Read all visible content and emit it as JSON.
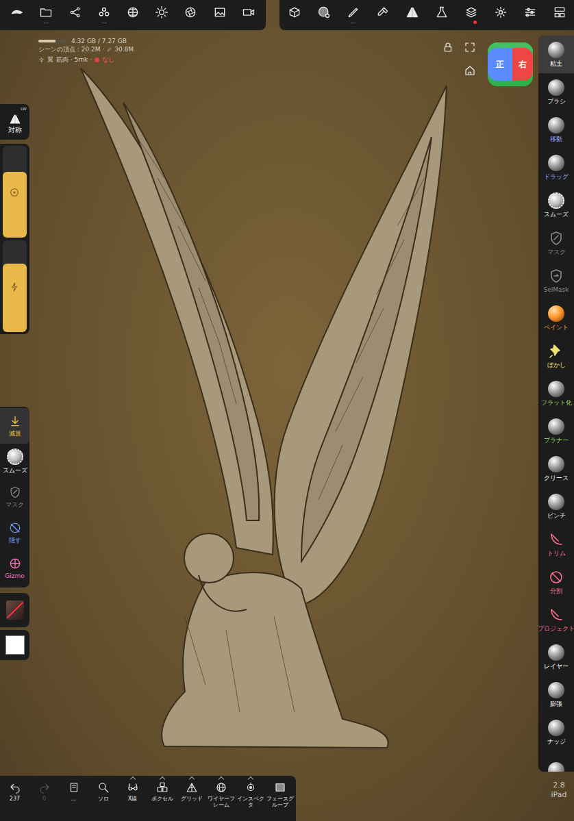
{
  "info": {
    "memory": "4.32 GB / 7.27 GB",
    "memory_level": 0.59,
    "vertices": "シーンの頂点 : 20.2M ·",
    "links": "30.8M",
    "object": "翼",
    "material": "筋肉 · 5mk ·",
    "status": "なし"
  },
  "top_left_tools": [
    {
      "kind": "logo",
      "more": ""
    },
    {
      "kind": "folder",
      "more": "..."
    },
    {
      "kind": "share",
      "more": ""
    },
    {
      "kind": "objects",
      "more": "..."
    },
    {
      "kind": "mesh",
      "more": ""
    },
    {
      "kind": "sun",
      "more": ""
    },
    {
      "kind": "aperture",
      "more": ""
    },
    {
      "kind": "image",
      "more": ""
    },
    {
      "kind": "video",
      "more": ""
    }
  ],
  "top_right_tools": [
    {
      "kind": "box",
      "more": "",
      "alert": false
    },
    {
      "kind": "material",
      "more": "",
      "alert": false
    },
    {
      "kind": "pen",
      "more": "...",
      "alert": false
    },
    {
      "kind": "dropper",
      "more": "",
      "alert": false
    },
    {
      "kind": "symmetry",
      "more": "",
      "alert": false
    },
    {
      "kind": "flask",
      "more": "",
      "alert": false
    },
    {
      "kind": "layers",
      "more": "",
      "alert": true
    },
    {
      "kind": "gear",
      "more": "",
      "alert": false
    },
    {
      "kind": "sliders",
      "more": "",
      "alert": false
    },
    {
      "kind": "hierarchy",
      "more": "",
      "alert": false
    }
  ],
  "view_cube": {
    "front": "正",
    "right": "右"
  },
  "right_tools": [
    {
      "label": "粘土",
      "kind": "sphere",
      "color": "#ffffff",
      "selected": true
    },
    {
      "label": "ブラシ",
      "kind": "sphere",
      "color": "#ffffff",
      "selected": false
    },
    {
      "label": "移動",
      "kind": "sphere",
      "color": "#9aa8ff",
      "selected": false
    },
    {
      "label": "ドラッグ",
      "kind": "sphere",
      "color": "#9aa8ff",
      "selected": false
    },
    {
      "label": "スムーズ",
      "kind": "fuzzy",
      "color": "#ffffff",
      "selected": false
    },
    {
      "label": "マスク",
      "kind": "shield",
      "color": "#8a8a8a",
      "selected": false
    },
    {
      "label": "SelMask",
      "kind": "selmask",
      "color": "#8a8a8a",
      "selected": false
    },
    {
      "label": "ペイント",
      "kind": "paint",
      "color": "#ffa040",
      "selected": false
    },
    {
      "label": "ぼかし",
      "kind": "pin",
      "color": "#f0e070",
      "selected": false
    },
    {
      "label": "フラット化",
      "kind": "sphere",
      "color": "#9fdc6a",
      "selected": false
    },
    {
      "label": "プラナー",
      "kind": "sphere",
      "color": "#9fdc6a",
      "selected": false
    },
    {
      "label": "クリース",
      "kind": "sphere",
      "color": "#ffffff",
      "selected": false
    },
    {
      "label": "ピンチ",
      "kind": "sphere",
      "color": "#ffffff",
      "selected": false
    },
    {
      "label": "トリム",
      "kind": "trim",
      "color": "#ff6f8f",
      "selected": false
    },
    {
      "label": "分割",
      "kind": "split",
      "color": "#ff6f8f",
      "selected": false
    },
    {
      "label": "プロジェクト",
      "kind": "trim",
      "color": "#ff6f8f",
      "selected": false
    },
    {
      "label": "レイヤー",
      "kind": "sphere",
      "color": "#ffffff",
      "selected": false
    },
    {
      "label": "膨張",
      "kind": "sphere",
      "color": "#ffffff",
      "selected": false
    },
    {
      "label": "ナッジ",
      "kind": "sphere",
      "color": "#ffffff",
      "selected": false
    },
    {
      "label": "",
      "kind": "sphere",
      "color": "#ffffff",
      "selected": false
    }
  ],
  "version": {
    "number": "2.8",
    "device": "iPad"
  },
  "symmetry": {
    "label": "対称",
    "badge": "LW"
  },
  "sliders": [
    {
      "kind": "radius",
      "level": 0.72
    },
    {
      "kind": "intensity",
      "level": 0.75
    }
  ],
  "left_tools": [
    {
      "label": "減算",
      "kind": "subtract",
      "color": "#f0c040",
      "selected": true
    },
    {
      "label": "スムーズ",
      "kind": "fuzzy",
      "color": "#ffffff",
      "selected": false
    },
    {
      "label": "マスク",
      "kind": "shield",
      "color": "#8a8a8a",
      "selected": false
    },
    {
      "label": "隠す",
      "kind": "hide",
      "color": "#6fa0ff",
      "selected": false
    },
    {
      "label": "Gizmo",
      "kind": "gizmo",
      "color": "#ff70c0",
      "selected": false
    }
  ],
  "stroke_material": {
    "enabled": false
  },
  "paint_color": "#ffffff",
  "bottom_tools": [
    {
      "label": "237",
      "kind": "undo",
      "caret": false,
      "disabled": false
    },
    {
      "label": "0",
      "kind": "redo",
      "caret": false,
      "disabled": true
    },
    {
      "label": "...",
      "kind": "book",
      "caret": false,
      "disabled": false
    },
    {
      "label": "ソロ",
      "kind": "search",
      "caret": false,
      "disabled": false
    },
    {
      "label": "X線",
      "kind": "glasses",
      "caret": true,
      "disabled": false
    },
    {
      "label": "ボクセル",
      "kind": "voxel",
      "caret": true,
      "disabled": false
    },
    {
      "label": "グリッド",
      "kind": "grid",
      "caret": true,
      "disabled": false
    },
    {
      "label": "ワイヤーフレーム",
      "kind": "wire",
      "caret": true,
      "disabled": false
    },
    {
      "label": "インスペクタ",
      "kind": "inspect",
      "caret": true,
      "disabled": false
    },
    {
      "label": "フェースグループ",
      "kind": "facegroup",
      "caret": false,
      "disabled": false
    }
  ]
}
